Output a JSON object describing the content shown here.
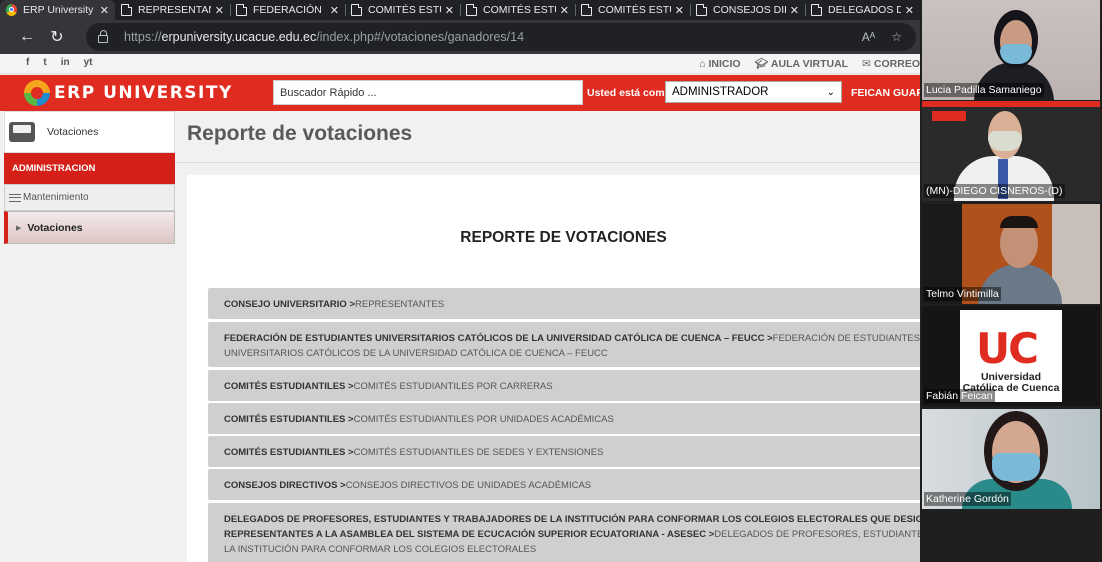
{
  "browser": {
    "tabs": [
      {
        "label": "ERP University",
        "active": true,
        "icon": "chrome-icon"
      },
      {
        "label": "REPRESENTAN",
        "active": false,
        "icon": "page-icon"
      },
      {
        "label": "FEDERACIÓN",
        "active": false,
        "icon": "page-icon"
      },
      {
        "label": "COMITÉS ESTU",
        "active": false,
        "icon": "page-icon"
      },
      {
        "label": "COMITÉS ESTU",
        "active": false,
        "icon": "page-icon"
      },
      {
        "label": "COMITÉS ESTU",
        "active": false,
        "icon": "page-icon"
      },
      {
        "label": "CONSEJOS DIR",
        "active": false,
        "icon": "page-icon"
      },
      {
        "label": "DELEGADOS D",
        "active": false,
        "icon": "page-icon"
      }
    ],
    "url_scheme": "https://",
    "url_host": "erpuniversity.ucacue.edu.ec",
    "url_path": "/index.php#/votaciones/ganadores/14"
  },
  "site": {
    "top_links": {
      "inicio": "INICIO",
      "aula": "AULA VIRTUAL",
      "correo": "CORREO"
    },
    "social": [
      "f",
      "t",
      "in",
      "yt"
    ],
    "logo_text": "ERP UNIVERSITY",
    "search_placeholder": "Buscador Rápido ...",
    "role_label": "Usted está como:",
    "role_value": "ADMINISTRADOR",
    "user_name": "FEICAN GUAPISACA"
  },
  "sidebar": {
    "module": "Votaciones",
    "section": "ADMINISTRACION",
    "group": "Mantenimiento",
    "item": "Votaciones"
  },
  "main": {
    "page_title": "Reporte de votaciones",
    "report_title": "REPORTE DE VOTACIONES",
    "items": [
      {
        "cat": "CONSEJO UNIVERSITARIO >",
        "sub": "REPRESENTANTES"
      },
      {
        "cat": "FEDERACIÓN DE ESTUDIANTES UNIVERSITARIOS CATÓLICOS DE LA UNIVERSIDAD CATÓLICA DE CUENCA – FEUCC >",
        "sub": "FEDERACIÓN DE ESTUDIANTES UNIVERSITARIOS CATÓLICOS DE LA UNIVERSIDAD CATÓLICA DE CUENCA – FEUCC"
      },
      {
        "cat": "COMITÉS ESTUDIANTILES >",
        "sub": "COMITÉS ESTUDIANTILES POR CARRERAS"
      },
      {
        "cat": "COMITÉS ESTUDIANTILES >",
        "sub": "COMITÉS ESTUDIANTILES POR UNIDADES ACADÉMICAS"
      },
      {
        "cat": "COMITÉS ESTUDIANTILES >",
        "sub": "COMITÉS ESTUDIANTILES DE SEDES Y EXTENSIONES"
      },
      {
        "cat": "CONSEJOS DIRECTIVOS >",
        "sub": "CONSEJOS DIRECTIVOS DE UNIDADES ACADÉMICAS"
      },
      {
        "cat": "DELEGADOS DE PROFESORES, ESTUDIANTES Y TRABAJADORES DE LA INSTITUCIÓN PARA CONFORMAR LOS COLEGIOS ELECTORALES QUE DESIGNARÁN A SUS REPRESENTANTES A LA ASAMBLEA DEL SISTEMA DE ECUCACIÓN SUPERIOR ECUATORIANA - ASESEC >",
        "sub": "DELEGADOS DE PROFESORES, ESTUDIANTES Y TRABAJADORES DE LA INSTITUCIÓN PARA CONFORMAR LOS COLEGIOS ELECTORALES"
      }
    ]
  },
  "participants": [
    {
      "name": "Lucia Padilla Samaniego"
    },
    {
      "name": "(MN)-DIEGO CISNEROS-(D)"
    },
    {
      "name": "Telmo Vintimilla"
    },
    {
      "name": "Fabián Feican"
    },
    {
      "name": "Katherine Gordón"
    }
  ],
  "uc_logo": {
    "mark": "UC",
    "line1": "Universidad",
    "line2": "Católica de Cuenca"
  },
  "colors": {
    "brand_red": "#e02b20",
    "chrome_dark": "#202124"
  }
}
